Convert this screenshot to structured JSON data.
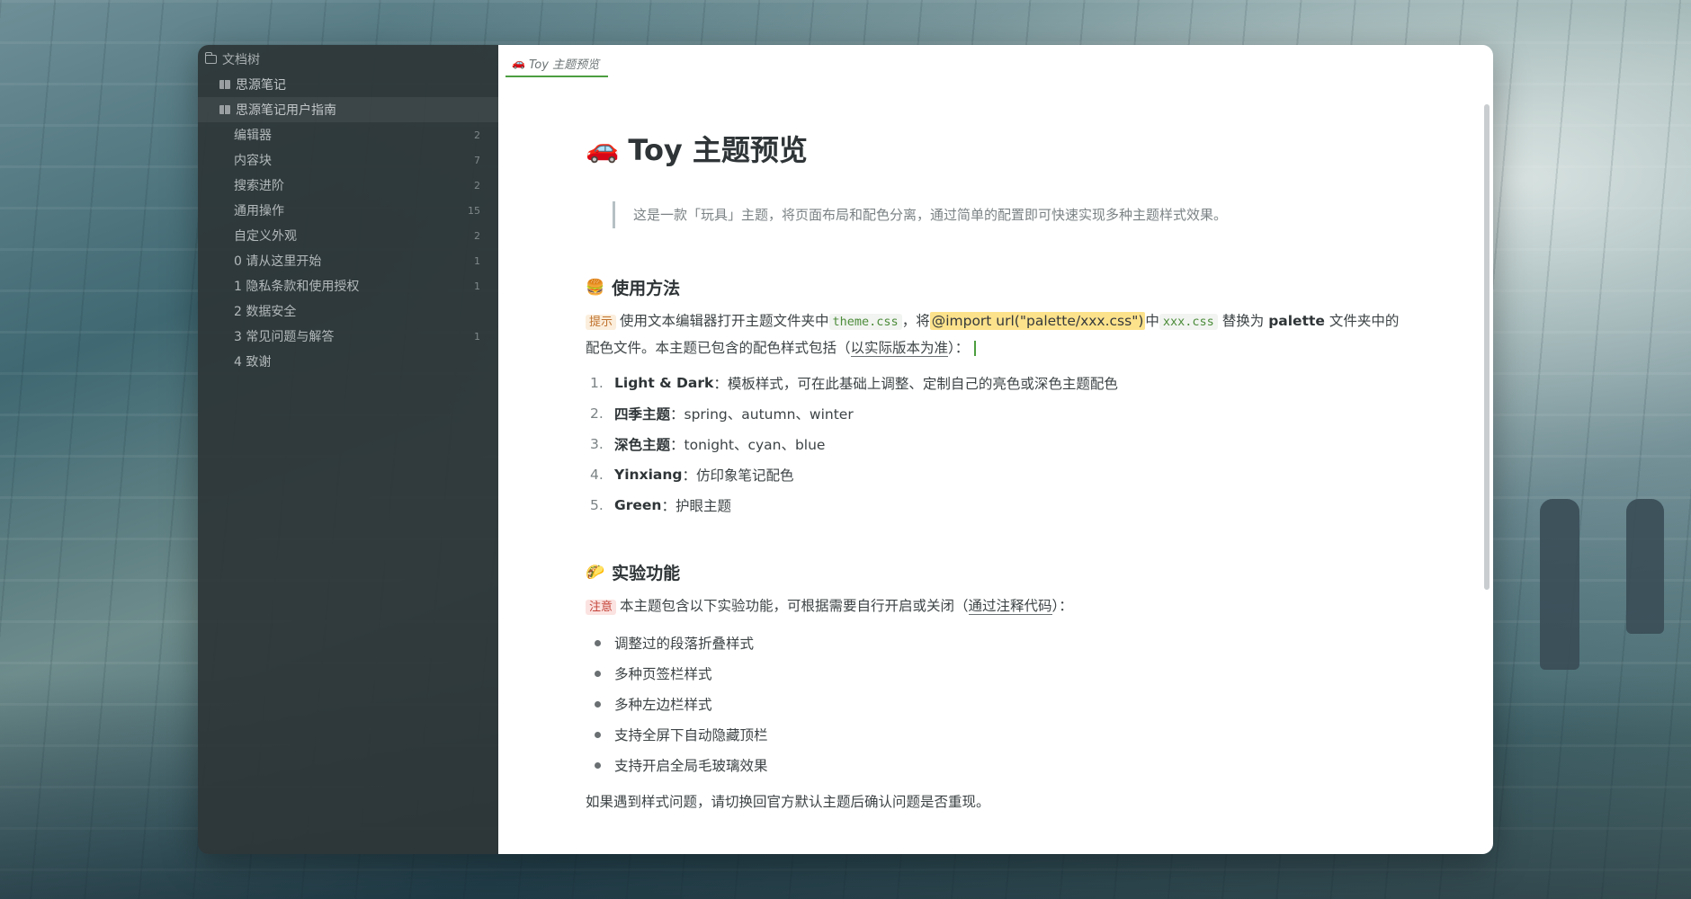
{
  "sidebar": {
    "title": "文档树",
    "notebooks": [
      {
        "label": "思源笔记"
      },
      {
        "label": "思源笔记用户指南"
      }
    ],
    "docs": [
      {
        "label": "编辑器",
        "count": "2"
      },
      {
        "label": "内容块",
        "count": "7"
      },
      {
        "label": "搜索进阶",
        "count": "2"
      },
      {
        "label": "通用操作",
        "count": "15"
      },
      {
        "label": "自定义外观",
        "count": "2"
      },
      {
        "label": "0 请从这里开始",
        "count": "1"
      },
      {
        "label": "1 隐私条款和使用授权",
        "count": "1"
      },
      {
        "label": "2 数据安全",
        "count": ""
      },
      {
        "label": "3 常见问题与解答",
        "count": "1"
      },
      {
        "label": "4 致谢",
        "count": ""
      }
    ]
  },
  "tab": {
    "icon": "🚗",
    "label": "Toy 主题预览"
  },
  "doc": {
    "title_emoji": "🚗",
    "title": "Toy 主题预览",
    "quote": "这是一款「玩具」主题，将页面布局和配色分离，通过简单的配置即可快速实现多种主题样式效果。",
    "usage": {
      "emoji": "🍔",
      "heading": "使用方法",
      "tip_tag": "提示",
      "p1": "使用文本编辑器打开主题文件夹中",
      "code1": "theme.css",
      "p2": "，将",
      "mark": "@import url(\"palette/xxx.css\")",
      "p3": "中",
      "code2": "xxx.css",
      "p4": "替换为",
      "bold": "palette",
      "p5": "文件夹中的配色文件。本主题已包含的配色样式包括（",
      "underline": "以实际版本为准",
      "p6": "）：",
      "items": [
        {
          "num": "1.",
          "bold": "Light & Dark",
          "text": "：模板样式，可在此基础上调整、定制自己的亮色或深色主题配色"
        },
        {
          "num": "2.",
          "bold": "四季主题",
          "text": "：spring、autumn、winter"
        },
        {
          "num": "3.",
          "bold": "深色主题",
          "text": "：tonight、cyan、blue"
        },
        {
          "num": "4.",
          "bold": "Yinxiang",
          "text": "：仿印象笔记配色"
        },
        {
          "num": "5.",
          "bold": "Green",
          "text": "：护眼主题"
        }
      ]
    },
    "experimental": {
      "emoji": "🌮",
      "heading": "实验功能",
      "note_tag": "注意",
      "p1": "本主题包含以下实验功能，可根据需要自行开启或关闭（",
      "underline": "通过注释代码",
      "p2": "）：",
      "items": [
        "调整过的段落折叠样式",
        "多种页签栏样式",
        "多种左边栏样式",
        "支持全屏下自动隐藏顶栏",
        "支持开启全局毛玻璃效果"
      ],
      "footer": "如果遇到样式问题，请切换回官方默认主题后确认问题是否重现。"
    }
  },
  "colors": {
    "accent": "#4c9e40",
    "sidebar_bg": "#2e3638",
    "highlight": "#fde28c"
  }
}
